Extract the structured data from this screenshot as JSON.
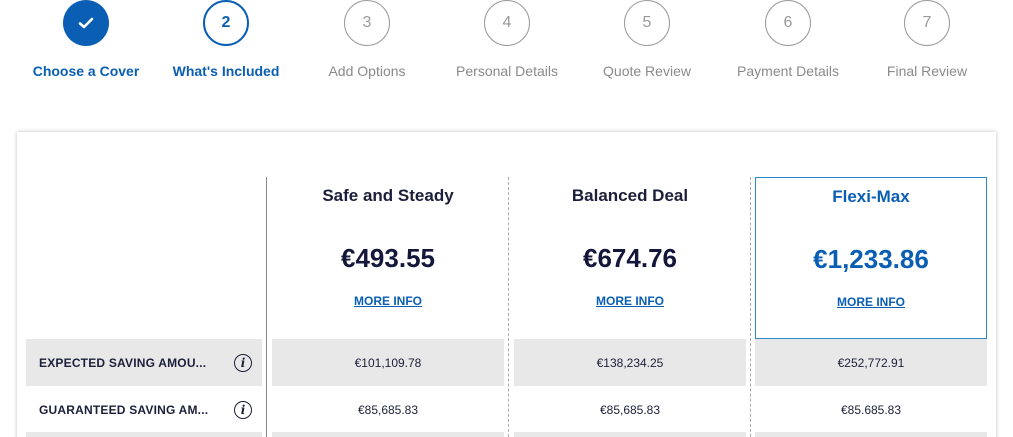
{
  "stepper": {
    "steps": [
      {
        "label": "Choose a Cover",
        "number": "",
        "icon": "check-icon",
        "state": "done"
      },
      {
        "label": "What's Included",
        "number": "2",
        "state": "current"
      },
      {
        "label": "Add Options",
        "number": "3",
        "state": "future"
      },
      {
        "label": "Personal Details",
        "number": "4",
        "state": "future"
      },
      {
        "label": "Quote Review",
        "number": "5",
        "state": "future"
      },
      {
        "label": "Payment Details",
        "number": "6",
        "state": "future"
      },
      {
        "label": "Final Review",
        "number": "7",
        "state": "future"
      }
    ]
  },
  "plans": [
    {
      "name": "Safe and Steady",
      "price": "€493.55",
      "more_info": "MORE INFO",
      "selected": false
    },
    {
      "name": "Balanced Deal",
      "price": "€674.76",
      "more_info": "MORE INFO",
      "selected": false
    },
    {
      "name": "Flexi-Max",
      "price": "€1,233.86",
      "more_info": "MORE INFO",
      "selected": true
    }
  ],
  "rows": [
    {
      "label": "EXPECTED SAVING AMOU...",
      "values": [
        "€101,109.78",
        "€138,234.25",
        "€252,772.91"
      ]
    },
    {
      "label": "GUARANTEED SAVING AM...",
      "values": [
        "€85,685.83",
        "€85,685.83",
        "€85.685.83"
      ]
    }
  ],
  "colors": {
    "accent": "#0a5fb4",
    "shade": "#e8e8e8",
    "text": "#1c1f3a",
    "muted": "#8a8a8a"
  }
}
